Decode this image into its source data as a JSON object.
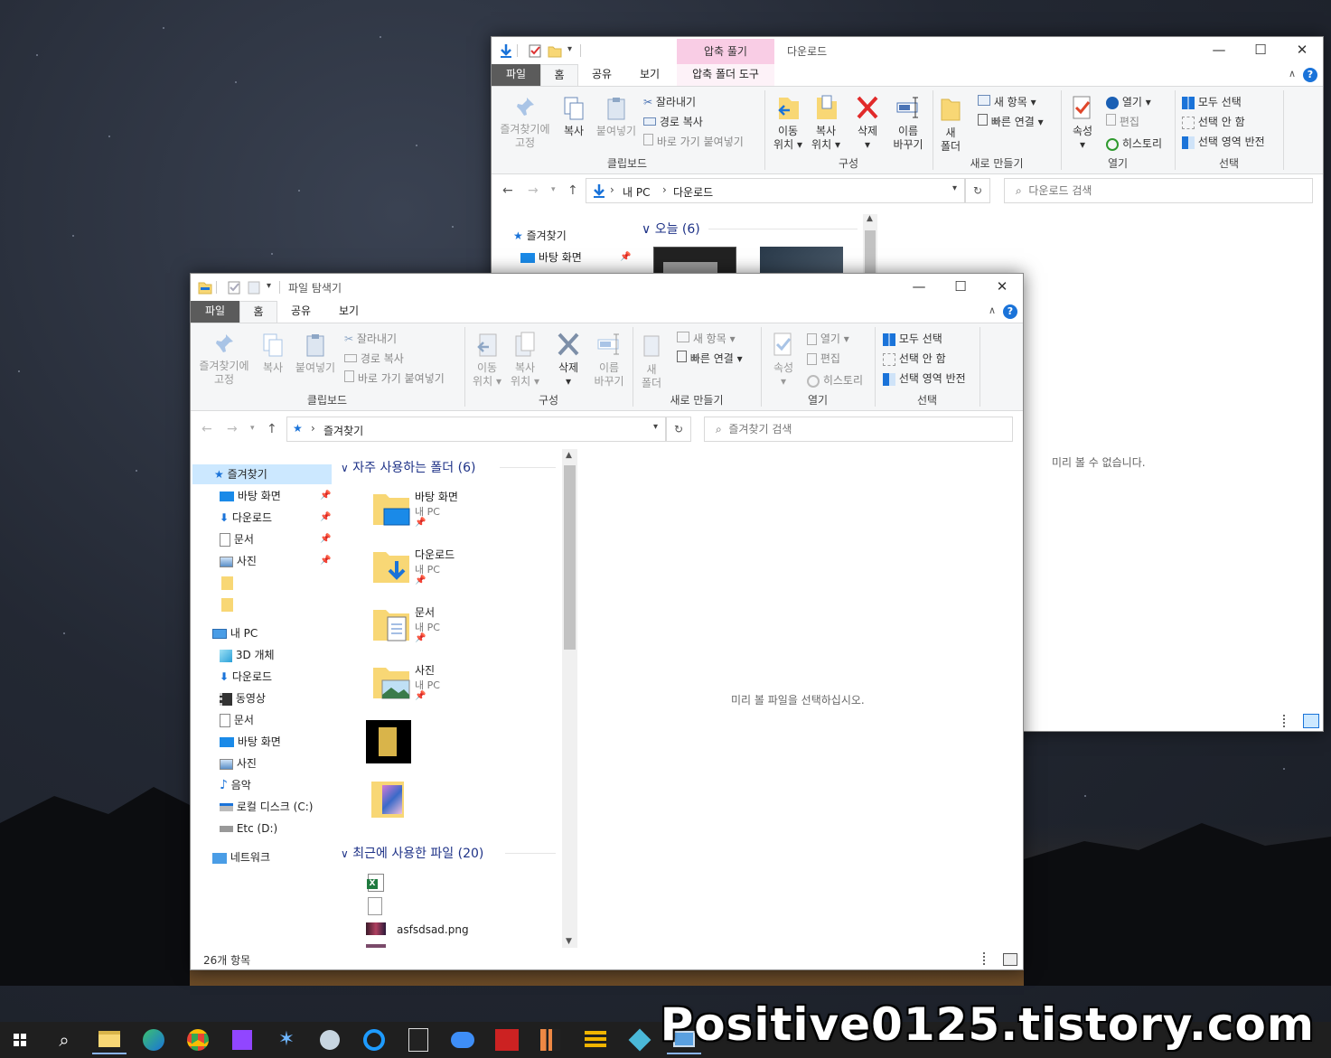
{
  "watermark": "Positive0125.tistory.com",
  "back_window": {
    "contextual_tab_header": "압축 풀기",
    "title": "다운로드",
    "tabs": [
      "파일",
      "홈",
      "공유",
      "보기",
      "압축 폴더 도구"
    ],
    "ribbon": {
      "pin": "즐겨찾기에\n고정",
      "copy": "복사",
      "paste": "붙여넣기",
      "cut": "잘라내기",
      "copy_path": "경로 복사",
      "paste_shortcut": "바로 가기 붙여넣기",
      "clipboard": "클립보드",
      "move_to": "이동\n위치",
      "copy_to": "복사\n위치",
      "delete": "삭제",
      "rename": "이름\n바꾸기",
      "organize": "구성",
      "new_folder": "새\n폴더",
      "new_item": "새 항목",
      "easy_access": "빠른 연결",
      "new": "새로 만들기",
      "properties": "속성",
      "open": "열기",
      "edit": "편집",
      "history": "히스토리",
      "open_group": "열기",
      "select_all": "모두 선택",
      "select_none": "선택 안 함",
      "invert": "선택 영역 반전",
      "select": "선택"
    },
    "address": {
      "pc": "내 PC",
      "folder": "다운로드"
    },
    "search_placeholder": "다운로드 검색",
    "nav": {
      "quick_access": "즐겨찾기",
      "desktop": "바탕 화면"
    },
    "group_today": "오늘 (6)",
    "preview": "미리 볼 수 없습니다."
  },
  "front_window": {
    "title": "파일 탐색기",
    "tabs": [
      "파일",
      "홈",
      "공유",
      "보기"
    ],
    "ribbon": {
      "pin": "즐겨찾기에\n고정",
      "copy": "복사",
      "paste": "붙여넣기",
      "cut": "잘라내기",
      "copy_path": "경로 복사",
      "paste_shortcut": "바로 가기 붙여넣기",
      "clipboard": "클립보드",
      "move_to": "이동\n위치",
      "copy_to": "복사\n위치",
      "delete": "삭제",
      "rename": "이름\n바꾸기",
      "organize": "구성",
      "new_folder": "새\n폴더",
      "new_item": "새 항목",
      "easy_access": "빠른 연결",
      "new": "새로 만들기",
      "properties": "속성",
      "open": "열기",
      "edit": "편집",
      "history": "히스토리",
      "open_group": "열기",
      "select_all": "모두 선택",
      "select_none": "선택 안 함",
      "invert": "선택 영역 반전",
      "select": "선택"
    },
    "address": {
      "location": "즐겨찾기"
    },
    "search_placeholder": "즐겨찾기 검색",
    "nav": {
      "quick_access": "즐겨찾기",
      "qa_items": [
        "바탕 화면",
        "다운로드",
        "문서",
        "사진"
      ],
      "this_pc": "내 PC",
      "pc_items": [
        "3D 개체",
        "다운로드",
        "동영상",
        "문서",
        "바탕 화면",
        "사진",
        "음악",
        "로컬 디스크 (C:)",
        "Etc (D:)"
      ],
      "network": "네트워크"
    },
    "frequent_header": "자주 사용하는 폴더 (6)",
    "frequent": [
      {
        "name": "바탕 화면",
        "sub": "내 PC"
      },
      {
        "name": "다운로드",
        "sub": "내 PC"
      },
      {
        "name": "문서",
        "sub": "내 PC"
      },
      {
        "name": "사진",
        "sub": "내 PC"
      }
    ],
    "recent_header": "최근에 사용한 파일 (20)",
    "recent_file": "asfsdsad.png",
    "status": "26개 항목",
    "preview": "미리 볼 파일을 선택하십시오."
  },
  "colors": {
    "accent": "#0078d7",
    "file_tab": "#5b5b5b",
    "contextual": "#f9cde5",
    "selected_nav": "#cce8ff",
    "header_blue": "#1e3287"
  }
}
